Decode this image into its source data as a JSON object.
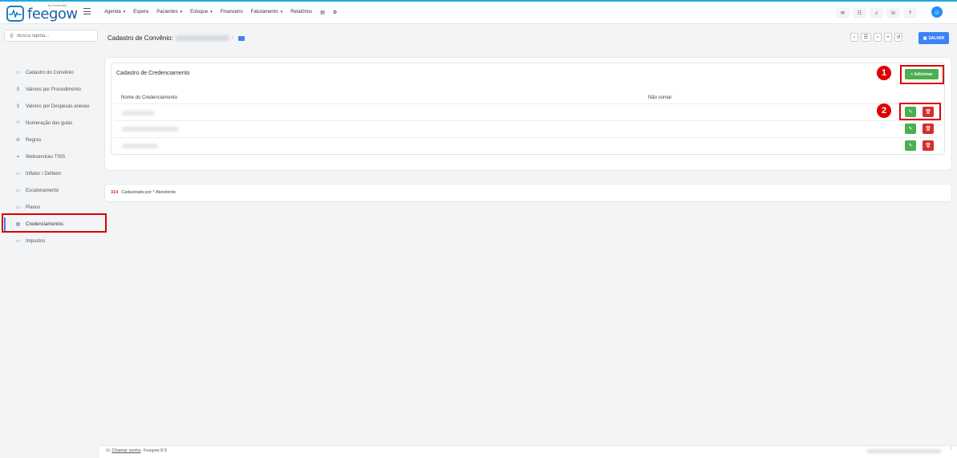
{
  "app": {
    "brand": "feegow",
    "brand_sub": "by Doctoralia",
    "version_label": "Feegow 8.9"
  },
  "nav": {
    "items": [
      {
        "label": "Agenda",
        "dropdown": true
      },
      {
        "label": "Espera",
        "dropdown": false
      },
      {
        "label": "Pacientes",
        "dropdown": true
      },
      {
        "label": "Estoque",
        "dropdown": true
      },
      {
        "label": "Financeiro",
        "dropdown": false
      },
      {
        "label": "Faturamento",
        "dropdown": true
      },
      {
        "label": "Relatórios",
        "dropdown": false
      }
    ],
    "caret": "▾",
    "extra_icons": [
      "print-icon",
      "gear-icon"
    ]
  },
  "top_actions": [
    "mail-icon",
    "chat-icon",
    "bell-icon",
    "message-icon",
    "help-icon"
  ],
  "search": {
    "placeholder": "Busca rápida..."
  },
  "header": {
    "title": "Cadastro de Convênio:",
    "save_label": "SALVAR"
  },
  "toolbar": {
    "buttons": [
      "chevron-left-icon",
      "list-icon",
      "chevron-right-icon",
      "plus-icon",
      "history-icon"
    ]
  },
  "sidebar": {
    "items": [
      {
        "label": "Cadastro do Convênio",
        "icon": "card-icon",
        "active": false
      },
      {
        "label": "Valores por Procedimento",
        "icon": "dollar-icon",
        "active": false
      },
      {
        "label": "Valores por Despesas anexas",
        "icon": "dollar-icon",
        "active": false
      },
      {
        "label": "Numeração das guias",
        "icon": "numbers-icon",
        "active": false
      },
      {
        "label": "Regras",
        "icon": "gears-icon",
        "active": false
      },
      {
        "label": "Webservices TISS",
        "icon": "link-icon",
        "active": false
      },
      {
        "label": "Inflator / Deflator",
        "icon": "card-icon",
        "active": false
      },
      {
        "label": "Escalonamento",
        "icon": "card-icon",
        "active": false
      },
      {
        "label": "Planos",
        "icon": "card-icon",
        "active": false
      },
      {
        "label": "Credenciamentos",
        "icon": "doc-icon",
        "active": true
      },
      {
        "label": "Impostos",
        "icon": "card-icon",
        "active": false
      }
    ]
  },
  "credenciamento": {
    "title": "Cadastro de Credenciamento",
    "add_label": "+ Adicionar",
    "col_name": "Nome do Credenciamento",
    "col_nao_somar": "Não somar",
    "rows": 3
  },
  "annotations": {
    "badge_1": "1",
    "badge_2": "2"
  },
  "log": {
    "id": "314",
    "text": "Cadastrado por * Atendente"
  },
  "footer": {
    "call_label": "Chamar senha"
  },
  "colors": {
    "accent": "#3b82f6",
    "success": "#4caf50",
    "danger": "#d32f2f",
    "highlight": "#dc0000",
    "topbar_line": "#20a8e0"
  }
}
